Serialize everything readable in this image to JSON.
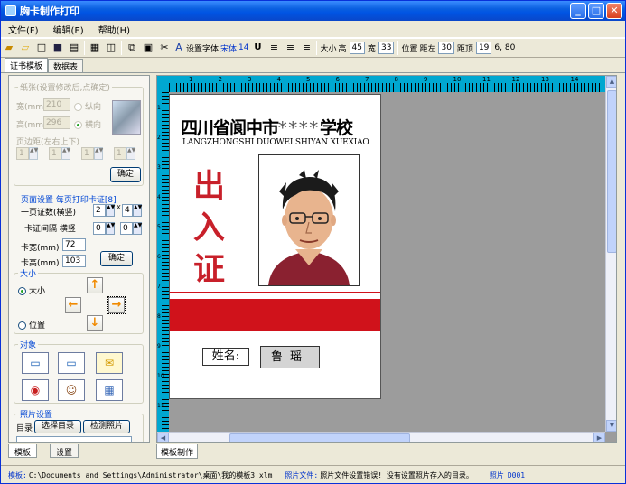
{
  "window": {
    "title": "胸卡制作打印",
    "minimize": "_",
    "maximize": "□",
    "close": "✕"
  },
  "menu": [
    "文件(F)",
    "编辑(E)",
    "帮助(H)"
  ],
  "toolbar": {
    "set_font_label": "设置字体",
    "font_name": "宋体",
    "font_size": "14",
    "underline": "U",
    "size_label": "大小",
    "height_label": "高",
    "height_value": "45",
    "width_label": "宽",
    "width_value": "33",
    "pos_label": "位置",
    "left_label": "距左",
    "left_value": "30",
    "top_label": "距顶",
    "top_value": "19",
    "coords": "6, 80"
  },
  "top_tabs": [
    "证书模板",
    "数据表"
  ],
  "paper": {
    "title": "纸张(设置修改后,点确定)",
    "width_label": "宽(mm)",
    "width_value": "210",
    "height_label": "高(mm)",
    "height_value": "296",
    "portrait": "纵向",
    "landscape": "横向",
    "margin_label": "页边距(左右上下)",
    "margins": [
      "1",
      "1",
      "1",
      "1"
    ],
    "ok": "确定"
  },
  "page_setup": {
    "title": "页面设置 每页打印卡证",
    "count_badge": "[8]",
    "per_page_label": "一页证数(横竖)",
    "per_page_h": "2",
    "x_sign": "X",
    "per_page_v": "4",
    "gap_label": "卡证间隔 横竖",
    "gap_h": "0",
    "gap_v": "0",
    "card_w_label": "卡宽(mm)",
    "card_w": "72",
    "card_h_label": "卡高(mm)",
    "card_h": "103",
    "ok": "确定"
  },
  "size_group": {
    "title": "大小",
    "size_radio": "大小",
    "pos_radio": "位置"
  },
  "objects": {
    "title": "对象"
  },
  "photo_settings": {
    "title": "照片设置",
    "dir_label": "目录",
    "select_dir": "选择目录",
    "check_photo": "检测照片"
  },
  "bottom_tabs": [
    "模板",
    "设置"
  ],
  "work_tab": "模板制作",
  "ruler_h": [
    "1",
    "2",
    "3",
    "4",
    "5",
    "6",
    "7",
    "8",
    "9",
    "10",
    "11",
    "12",
    "13",
    "14"
  ],
  "ruler_v": [
    "1",
    "2",
    "3",
    "4",
    "5",
    "6",
    "7",
    "8",
    "9",
    "10",
    "11"
  ],
  "card": {
    "school_prefix": "四川省阆中市",
    "school_stars": "****",
    "school_suffix": "学校",
    "school_en": "LANGZHONGSHI DUOWEI SHIYAN XUEXIAO",
    "big_chars": [
      "出",
      "入",
      "证"
    ],
    "name_label": "姓名:",
    "name_value": "鲁瑶"
  },
  "status": {
    "template_label": "模板:",
    "template_path": "C:\\Documents and Settings\\Administrator\\桌面\\我的模板3.xlm",
    "photo_file_label": "照片文件:",
    "photo_file_msg": "照片文件设置错误! 没有设置照片存入的目录。",
    "photo_label": "照片",
    "photo_id": "D001"
  },
  "colors": {
    "accent": "#0054e3",
    "ruler": "#00a7d0",
    "card_red": "#d0121b"
  }
}
